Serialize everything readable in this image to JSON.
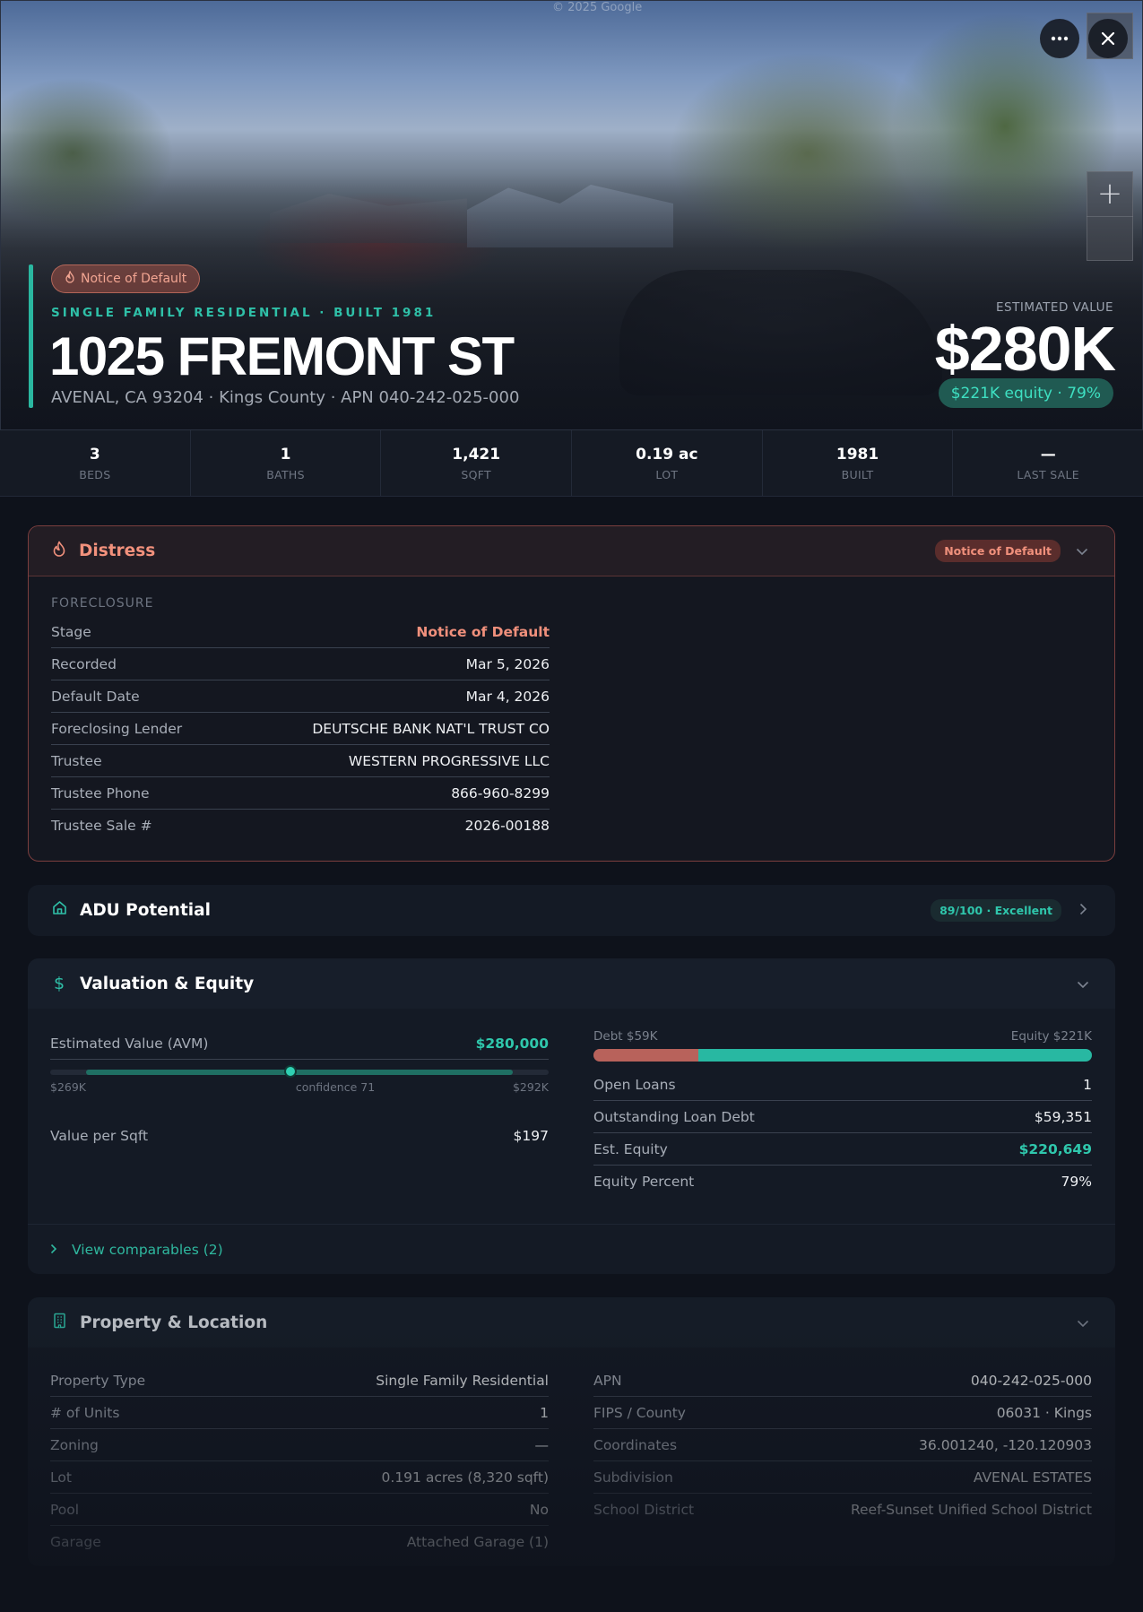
{
  "hero": {
    "watermark": "© 2025 Google",
    "status_pill": "Notice of Default",
    "subtype": "SINGLE FAMILY RESIDENTIAL · BUILT 1981",
    "address": "1025 FREMONT ST",
    "address_sub": "AVENAL, CA 93204 · Kings County · APN 040-242-025-000",
    "est_label": "ESTIMATED VALUE",
    "est_value": "$280K",
    "equity_pill": "$221K equity · 79%",
    "more_icon": "more-horizontal-icon",
    "close_icon": "close-icon",
    "zoom_in": "+"
  },
  "stats": [
    {
      "value": "3",
      "label": "BEDS"
    },
    {
      "value": "1",
      "label": "BATHS"
    },
    {
      "value": "1,421",
      "label": "SQFT"
    },
    {
      "value": "0.19 ac",
      "label": "LOT"
    },
    {
      "value": "1981",
      "label": "BUILT"
    },
    {
      "value": "—",
      "label": "LAST SALE"
    }
  ],
  "distress": {
    "title": "Distress",
    "badge": "Notice of Default",
    "section": "FORECLOSURE",
    "rows": [
      {
        "k": "Stage",
        "v": "Notice of Default"
      },
      {
        "k": "Recorded",
        "v": "Mar 5, 2026"
      },
      {
        "k": "Default Date",
        "v": "Mar 4, 2026"
      },
      {
        "k": "Foreclosing Lender",
        "v": "DEUTSCHE BANK NAT'L TRUST CO"
      },
      {
        "k": "Trustee",
        "v": "WESTERN PROGRESSIVE LLC"
      },
      {
        "k": "Trustee Phone",
        "v": "866-960-8299"
      },
      {
        "k": "Trustee Sale #",
        "v": "2026-00188"
      }
    ]
  },
  "adu": {
    "title": "ADU Potential",
    "badge": "89/100 · Excellent"
  },
  "valuation": {
    "title": "Valuation & Equity",
    "avm_label": "Estimated Value (AVM)",
    "avm_value": "$280,000",
    "range_low": "$269K",
    "range_high": "$292K",
    "confidence": "confidence 71",
    "range_min": 269000,
    "range_max": 292000,
    "estimate": 280000,
    "vps_label": "Value per Sqft",
    "vps_value": "$197",
    "debt_label": "Debt $59K",
    "equity_label": "Equity $221K",
    "debt_fraction": 0.21,
    "rows": [
      {
        "k": "Open Loans",
        "v": "1"
      },
      {
        "k": "Outstanding Loan Debt",
        "v": "$59,351"
      },
      {
        "k": "Est. Equity",
        "v": "$220,649"
      },
      {
        "k": "Equity Percent",
        "v": "79%"
      }
    ],
    "comps": "View comparables (2)"
  },
  "property": {
    "title": "Property & Location",
    "left": [
      {
        "k": "Property Type",
        "v": "Single Family Residential"
      },
      {
        "k": "# of Units",
        "v": "1"
      },
      {
        "k": "Zoning",
        "v": "—"
      },
      {
        "k": "Lot",
        "v": "0.191 acres (8,320 sqft)"
      },
      {
        "k": "Pool",
        "v": "No"
      },
      {
        "k": "Garage",
        "v": "Attached Garage (1)"
      }
    ],
    "right": [
      {
        "k": "APN",
        "v": "040-242-025-000"
      },
      {
        "k": "FIPS / County",
        "v": "06031 · Kings"
      },
      {
        "k": "Coordinates",
        "v": "36.001240, -120.120903"
      },
      {
        "k": "Subdivision",
        "v": "AVENAL ESTATES"
      },
      {
        "k": "School District",
        "v": "Reef-Sunset Unified School District"
      }
    ]
  },
  "colors": {
    "accent": "#2ab7a0",
    "distress": "#f0907c",
    "debt": "#b8625b",
    "equity": "#28b8a2"
  }
}
